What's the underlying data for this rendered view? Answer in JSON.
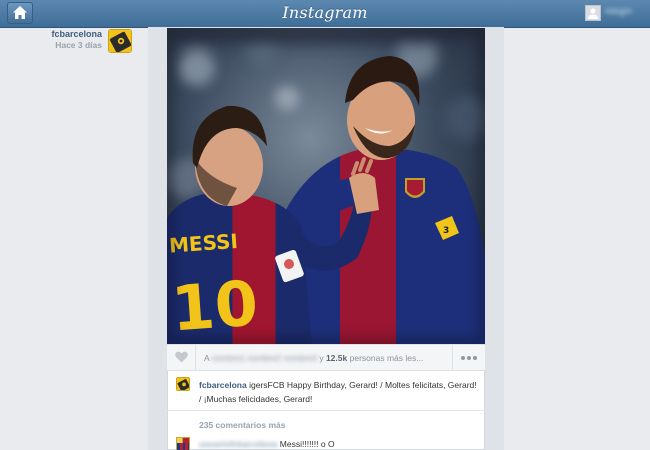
{
  "header": {
    "logo": "Instagram",
    "username": "mlogm"
  },
  "post": {
    "username": "fcbarcelona",
    "time_ago": "Hace 3 días",
    "likes": {
      "prefix": "A",
      "blurred_names": "nombre1 nombre2 nombre3",
      "conjunction": "y",
      "count": "12.5k",
      "suffix": "personas más les..."
    },
    "caption": {
      "user": "fcbarcelona",
      "text": "igersFCB Happy Birthday, Gerard! / Moltes felicitats, Gerard! / ¡Muchas felicidades, Gerard!"
    },
    "more_comments": "235 comentarios más",
    "comments": [
      {
        "user": "usuariofcbarcelona",
        "text": "Messi!!!!!!! o O"
      }
    ]
  },
  "icons": {
    "home": "home-icon",
    "heart": "heart-icon",
    "more": "ellipsis-icon",
    "avatar": "user-silhouette-icon"
  },
  "colors": {
    "topbar": "#4a7aa5",
    "link": "#3f5f7e",
    "card_bg": "#ffffff",
    "page_bg": "#e9ebee"
  }
}
